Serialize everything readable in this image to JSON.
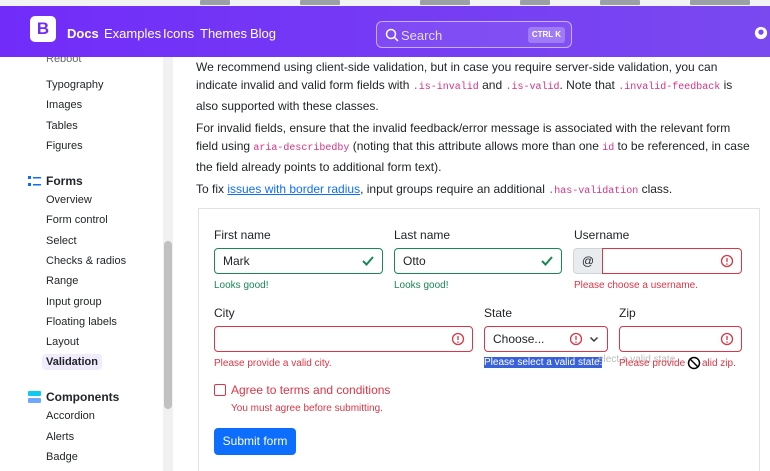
{
  "navbar": {
    "brand_letter": "B",
    "links": [
      "Docs",
      "Examples",
      "Icons",
      "Themes",
      "Blog"
    ],
    "search": {
      "placeholder": "Search",
      "shortcut": "CTRL K"
    },
    "colors": {
      "primary": "#712cf9"
    }
  },
  "sidebar": {
    "cut_item": "Reboot",
    "content_items": [
      "Typography",
      "Images",
      "Tables",
      "Figures"
    ],
    "forms_heading": "Forms",
    "forms_items": [
      "Overview",
      "Form control",
      "Select",
      "Checks & radios",
      "Range",
      "Input group",
      "Floating labels",
      "Layout"
    ],
    "active_item": "Validation",
    "components_heading": "Components",
    "components_items": [
      "Accordion",
      "Alerts",
      "Badge"
    ]
  },
  "main": {
    "p1": {
      "t1": "We recommend using client-side validation, but in case you require server-side validation, you can indicate invalid and valid form fields with ",
      "c1": ".is-invalid",
      "t2": " and ",
      "c2": ".is-valid",
      "t3": ". Note that ",
      "c3": ".invalid-feedback",
      "t4": " is also supported with these classes."
    },
    "p2": {
      "t1": "For invalid fields, ensure that the invalid feedback/error message is associated with the relevant form field using ",
      "c1": "aria-describedby",
      "t2": " (noting that this attribute allows more than one ",
      "c2": "id",
      "t3": " to be referenced, in case the field already points to additional form text)."
    },
    "p3": {
      "t1": "To fix ",
      "link": "issues with border radius",
      "t2": ", input groups require an additional ",
      "c1": ".has-validation",
      "t3": " class."
    }
  },
  "form": {
    "first_name": {
      "label": "First name",
      "value": "Mark",
      "feedback": "Looks good!"
    },
    "last_name": {
      "label": "Last name",
      "value": "Otto",
      "feedback": "Looks good!"
    },
    "username": {
      "label": "Username",
      "prefix": "@",
      "value": "",
      "feedback": "Please choose a username."
    },
    "city": {
      "label": "City",
      "value": "",
      "feedback": "Please provide a valid city."
    },
    "state": {
      "label": "State",
      "selected": "Choose...",
      "feedback": "Please select a valid state.",
      "ghost": "elect a valid state."
    },
    "zip": {
      "label": "Zip",
      "value": "",
      "feedback_a": "Please provide ",
      "feedback_b": "alid zip."
    },
    "terms": {
      "label": "Agree to terms and conditions",
      "feedback": "You must agree before submitting."
    },
    "submit_label": "Submit form",
    "colors": {
      "valid": "#198754",
      "invalid": "#dc3545",
      "button": "#0d6efd"
    }
  }
}
